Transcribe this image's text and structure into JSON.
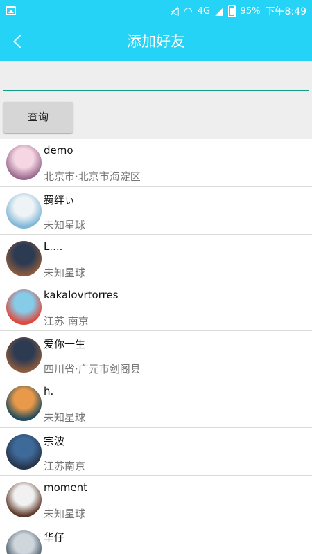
{
  "status_bar": {
    "battery": "95%",
    "network": "4G",
    "time": "下午8:49"
  },
  "app_bar": {
    "title": "添加好友"
  },
  "search": {
    "value": "",
    "placeholder": "",
    "button_label": "查询"
  },
  "users": [
    {
      "name": "demo",
      "location": "北京市·北京市海淀区",
      "avatar_colors": [
        "#f5d6e2",
        "#9a6b8e"
      ]
    },
    {
      "name": "羁绊ぃ",
      "location": "未知星球",
      "avatar_colors": [
        "#eef3f6",
        "#7fb6d6"
      ]
    },
    {
      "name": "L....",
      "location": "未知星球",
      "avatar_colors": [
        "#2c3a52",
        "#8a5a3e"
      ]
    },
    {
      "name": "kakalovrtorres",
      "location": "江苏 南京",
      "avatar_colors": [
        "#86cbe8",
        "#e0463a"
      ]
    },
    {
      "name": "爱你一生",
      "location": "四川省·广元市剑阁县",
      "avatar_colors": [
        "#2c3a52",
        "#8a5a3e"
      ]
    },
    {
      "name": "h.",
      "location": "未知星球",
      "avatar_colors": [
        "#e89a4a",
        "#1f4a5e"
      ]
    },
    {
      "name": "宗波",
      "location": "江苏南京",
      "avatar_colors": [
        "#3e6a9a",
        "#26344a"
      ]
    },
    {
      "name": "moment",
      "location": "未知星球",
      "avatar_colors": [
        "#f1f1f1",
        "#5e3a2a"
      ]
    },
    {
      "name": "华仔",
      "location": "",
      "avatar_colors": [
        "#cfd6dc",
        "#4a5a6a"
      ]
    }
  ]
}
